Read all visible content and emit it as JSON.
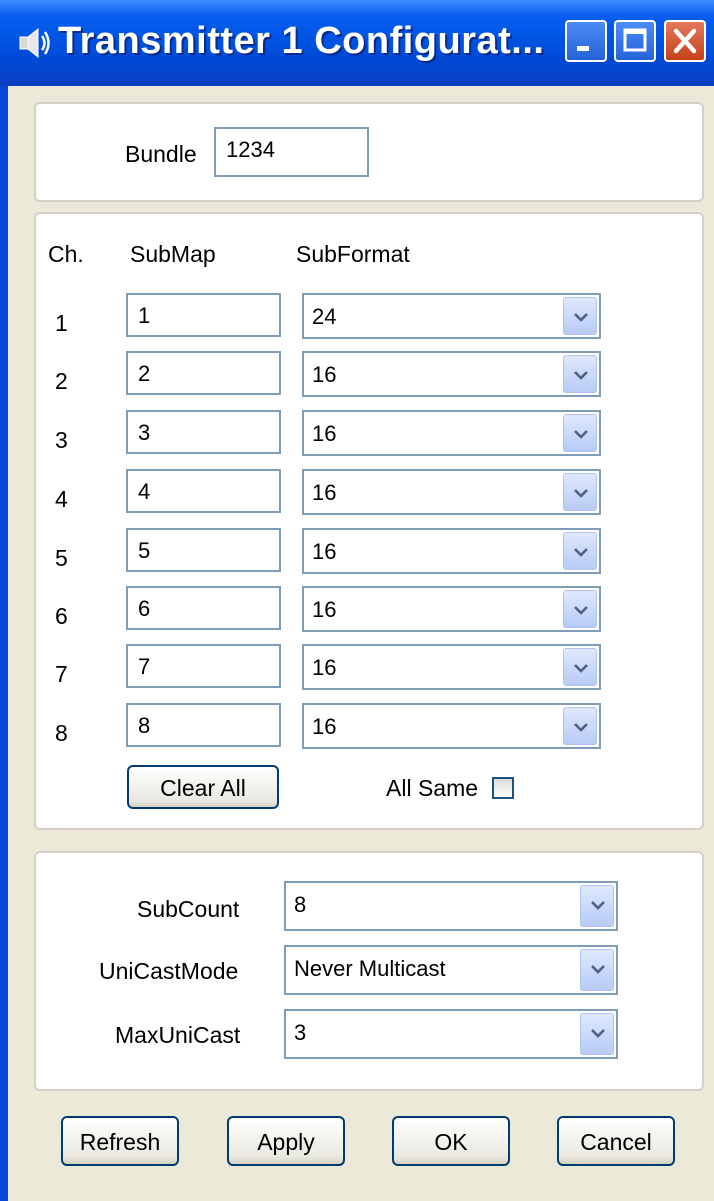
{
  "window": {
    "title": "Transmitter 1 Configurat..."
  },
  "bundle": {
    "label": "Bundle",
    "value": "1234"
  },
  "channels": {
    "header_ch": "Ch.",
    "header_submap": "SubMap",
    "header_subformat": "SubFormat",
    "rows": [
      {
        "ch": "1",
        "submap": "1",
        "subformat": "24"
      },
      {
        "ch": "2",
        "submap": "2",
        "subformat": "16"
      },
      {
        "ch": "3",
        "submap": "3",
        "subformat": "16"
      },
      {
        "ch": "4",
        "submap": "4",
        "subformat": "16"
      },
      {
        "ch": "5",
        "submap": "5",
        "subformat": "16"
      },
      {
        "ch": "6",
        "submap": "6",
        "subformat": "16"
      },
      {
        "ch": "7",
        "submap": "7",
        "subformat": "16"
      },
      {
        "ch": "8",
        "submap": "8",
        "subformat": "16"
      }
    ],
    "clear_all_label": "Clear All",
    "all_same_label": "All Same",
    "all_same_checked": false
  },
  "settings": {
    "subcount_label": "SubCount",
    "subcount_value": "8",
    "unicast_label": "UniCastMode",
    "unicast_value": "Never Multicast",
    "maxunicast_label": "MaxUniCast",
    "maxunicast_value": "3"
  },
  "footer": {
    "refresh_label": "Refresh",
    "apply_label": "Apply",
    "ok_label": "OK",
    "cancel_label": "Cancel"
  },
  "icons": {
    "window_icon": "speaker-icon",
    "minimize": "minimize-icon",
    "maximize": "maximize-icon",
    "close": "close-icon",
    "dropdown": "chevron-down-icon"
  },
  "colors": {
    "titlebar": "#0054e3",
    "close_button": "#c8401c",
    "input_border": "#7f9db9"
  }
}
